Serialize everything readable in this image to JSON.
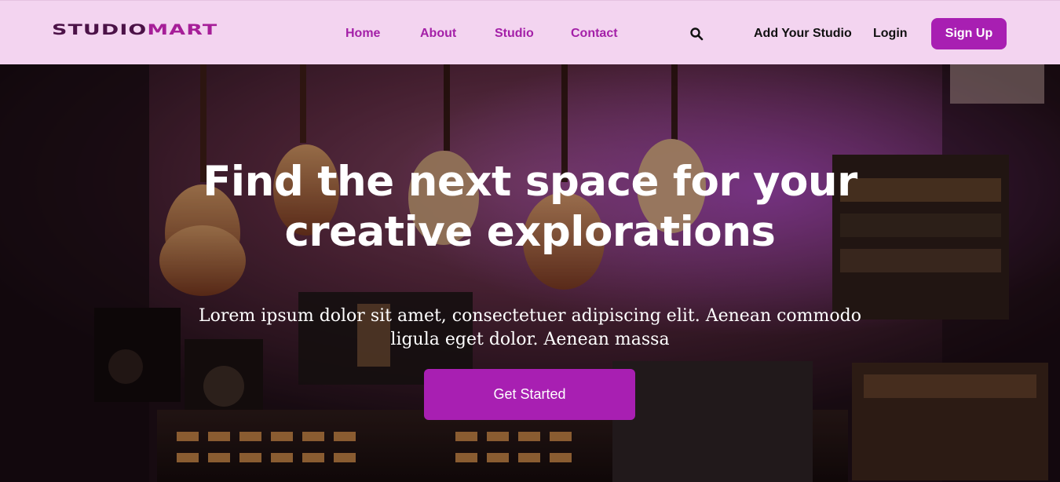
{
  "brand": {
    "logo_part1": "STUDIO",
    "logo_part2": "MART"
  },
  "nav": {
    "links": [
      {
        "label": "Home"
      },
      {
        "label": "About"
      },
      {
        "label": "Studio"
      },
      {
        "label": "Contact"
      }
    ],
    "search_icon": "search-icon",
    "add_studio": "Add Your Studio",
    "login": "Login",
    "signup": "Sign Up"
  },
  "hero": {
    "title": "Find the next space for your creative explorations",
    "subtitle": "Lorem ipsum dolor sit amet, consectetuer adipiscing elit. Aenean commodo ligula eget dolor. Aenean massa",
    "cta": "Get Started"
  },
  "colors": {
    "nav_bg": "#f3d4f0",
    "accent": "#a81fb2",
    "nav_link": "#a420a8",
    "logo_dark": "#4b1247"
  }
}
